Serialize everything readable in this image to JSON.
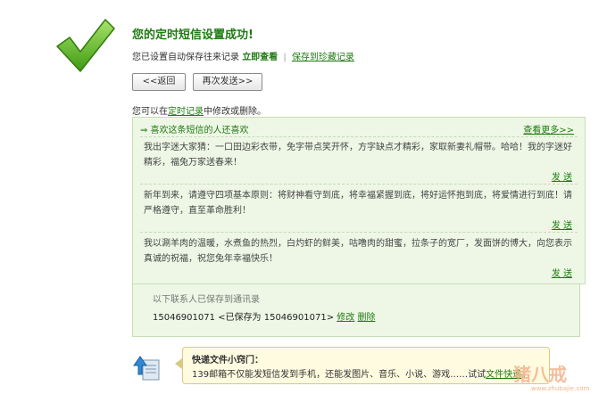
{
  "header": {
    "title": "您的定时短信设置成功!",
    "subline_text": "您已设置自动保存往来记录",
    "view_now_link": "立即查看",
    "separator": "|",
    "save_to_favorites_link": "保存到珍藏记录"
  },
  "buttons": {
    "back_label": "<<返回",
    "resend_label": "再次发送>>"
  },
  "edit_line": {
    "prefix": "您可以在",
    "link": "定时记录",
    "suffix": "中修改或删除。"
  },
  "suggestions": {
    "title": "⇒ 喜欢这条短信的人还喜欢",
    "more_link": "查看更多>>",
    "items": [
      {
        "text": "我出字迷大家猜：一口田边彩衣带，免字带点笑开怀，方字缺点才精彩，家取新妻礼帽带。哈哈！我的字迷好精彩，福兔万家送春来！",
        "send_label": "发 送"
      },
      {
        "text": "新年到来，请遵守四项基本原则：将财神看守到底，将幸福紧握到底，将好运怀抱到底，将爱情进行到底！请严格遵守，直至革命胜利！",
        "send_label": "发 送"
      },
      {
        "text": "我以涮羊肉的温暖，水煮鱼的热烈，白灼虾的鲜美，咕噜肉的甜蜜，拉条子的宽厂，发面饼的博大，向您表示真诚的祝福，祝您兔年幸福快乐！",
        "send_label": "发 送"
      }
    ]
  },
  "contacts": {
    "title": "以下联系人已保存到通讯录",
    "row_text": "15046901071 <已保存为 15046901071>",
    "edit_link": "修改",
    "delete_link": "删除"
  },
  "tip": {
    "title": "快递文件小窍门：",
    "text": "139邮箱不仅能发短信发到手机，还能发图片、音乐、小说、游戏……试试",
    "link": "文件快递",
    "suffix": "。"
  },
  "watermark": {
    "text": "猪八戒",
    "url": "www.zhubajie.com"
  },
  "colors": {
    "accent_green": "#1f7a12",
    "panel_bg": "#eef7e6",
    "tip_bg": "#fffbe1"
  },
  "icons": {
    "success": "check-icon",
    "tip": "upload-document-icon"
  }
}
